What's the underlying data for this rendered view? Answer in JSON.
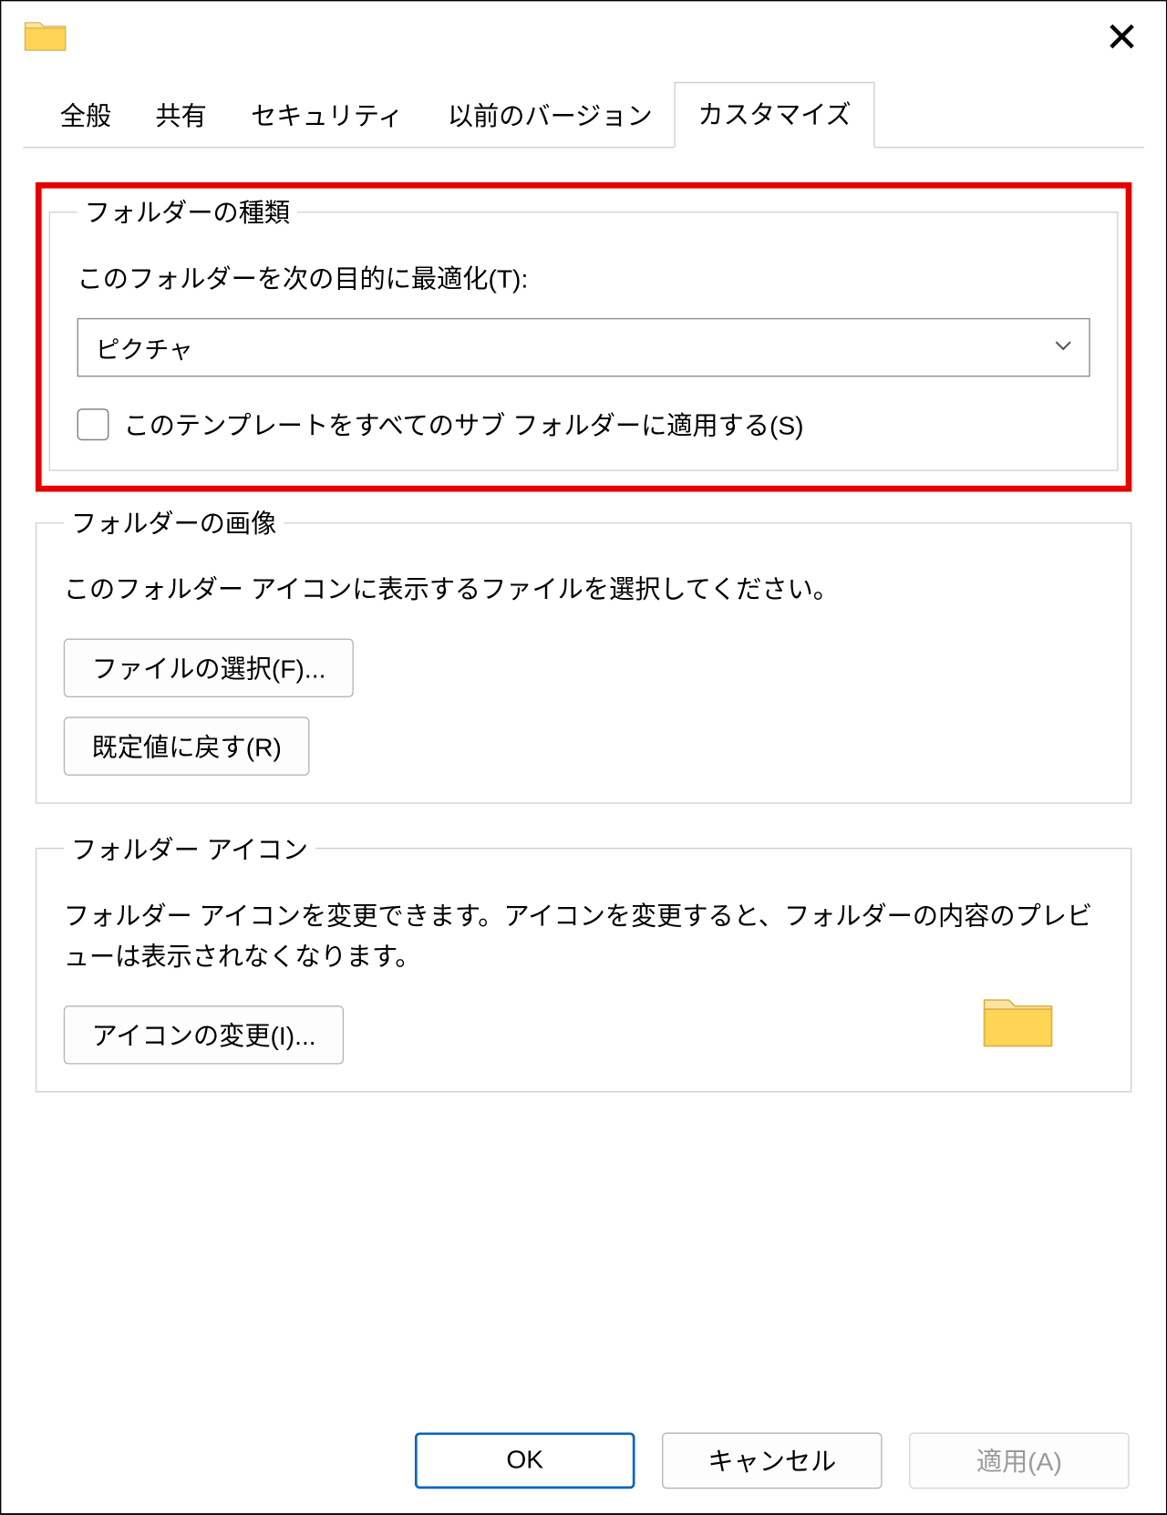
{
  "titlebar": {
    "close_glyph": "✕"
  },
  "tabs": {
    "items": [
      "全般",
      "共有",
      "セキュリティ",
      "以前のバージョン",
      "カスタマイズ"
    ],
    "active_index": 4
  },
  "folder_type": {
    "legend": "フォルダーの種類",
    "optimize_label": "このフォルダーを次の目的に最適化(T):",
    "selected_value": "ピクチャ",
    "apply_subfolders_label": "このテンプレートをすべてのサブ フォルダーに適用する(S)",
    "apply_subfolders_checked": false
  },
  "folder_image": {
    "legend": "フォルダーの画像",
    "description": "このフォルダー アイコンに表示するファイルを選択してください。",
    "choose_file_label": "ファイルの選択(F)...",
    "restore_default_label": "既定値に戻す(R)"
  },
  "folder_icon": {
    "legend": "フォルダー アイコン",
    "description": "フォルダー アイコンを変更できます。アイコンを変更すると、フォルダーの内容のプレビューは表示されなくなります。",
    "change_icon_label": "アイコンの変更(I)..."
  },
  "footer": {
    "ok_label": "OK",
    "cancel_label": "キャンセル",
    "apply_label": "適用(A)"
  },
  "colors": {
    "highlight": "#e60000",
    "primary_border": "#0a64c2"
  }
}
